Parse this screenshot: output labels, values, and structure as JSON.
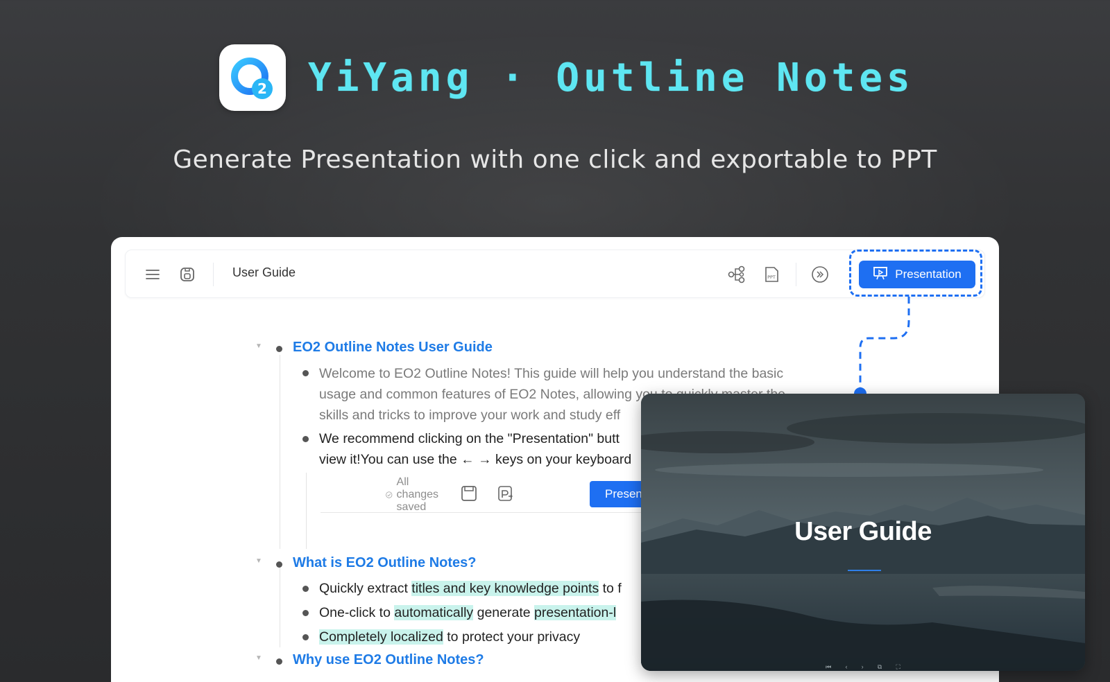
{
  "brand": {
    "title": "YiYang · Outline Notes",
    "subtitle": "Generate Presentation with one click and exportable to PPT",
    "accent": "#5ee6f2",
    "icon": "eo2-logo-icon"
  },
  "toolbar": {
    "doc_title": "User Guide",
    "present_label": "Presentation",
    "icons": [
      "menu-icon",
      "save-icon",
      "mindmap-icon",
      "ppt-export-icon",
      "expand-icon",
      "presentation-icon"
    ],
    "accent": "#1e6ff2"
  },
  "outline": {
    "sections": [
      {
        "title": "EO2 Outline Notes User Guide",
        "items": [
          {
            "lines": [
              "Welcome to EO2 Outline Notes! This guide will help you understand the basic",
              "usage and common features of EO2 Notes, allowing you to quickly master the",
              "skills and tricks to improve your work and study eff"
            ]
          },
          {
            "lines": [
              "We recommend clicking on the \"Presentation\" butt",
              "view it!You can use the ← → keys on your keyboard"
            ]
          }
        ],
        "embed": {
          "saved_label": "All changes saved",
          "present_label": "Presentation"
        }
      },
      {
        "title": "What is EO2 Outline Notes?",
        "items": [
          {
            "pre": "Quickly extract ",
            "hl": "titles and key knowledge points",
            "post": " to f"
          },
          {
            "pre": "One-click to ",
            "hl": "automatically",
            "mid": " generate ",
            "hl2": "presentation-l"
          },
          {
            "hl": "Completely localized",
            "post": " to protect your privacy"
          }
        ]
      },
      {
        "title": "Why use EO2 Outline Notes?"
      }
    ]
  },
  "slide": {
    "title": "User Guide",
    "controls": [
      "⏮",
      "‹",
      "›",
      "⧉",
      "⛶"
    ]
  }
}
